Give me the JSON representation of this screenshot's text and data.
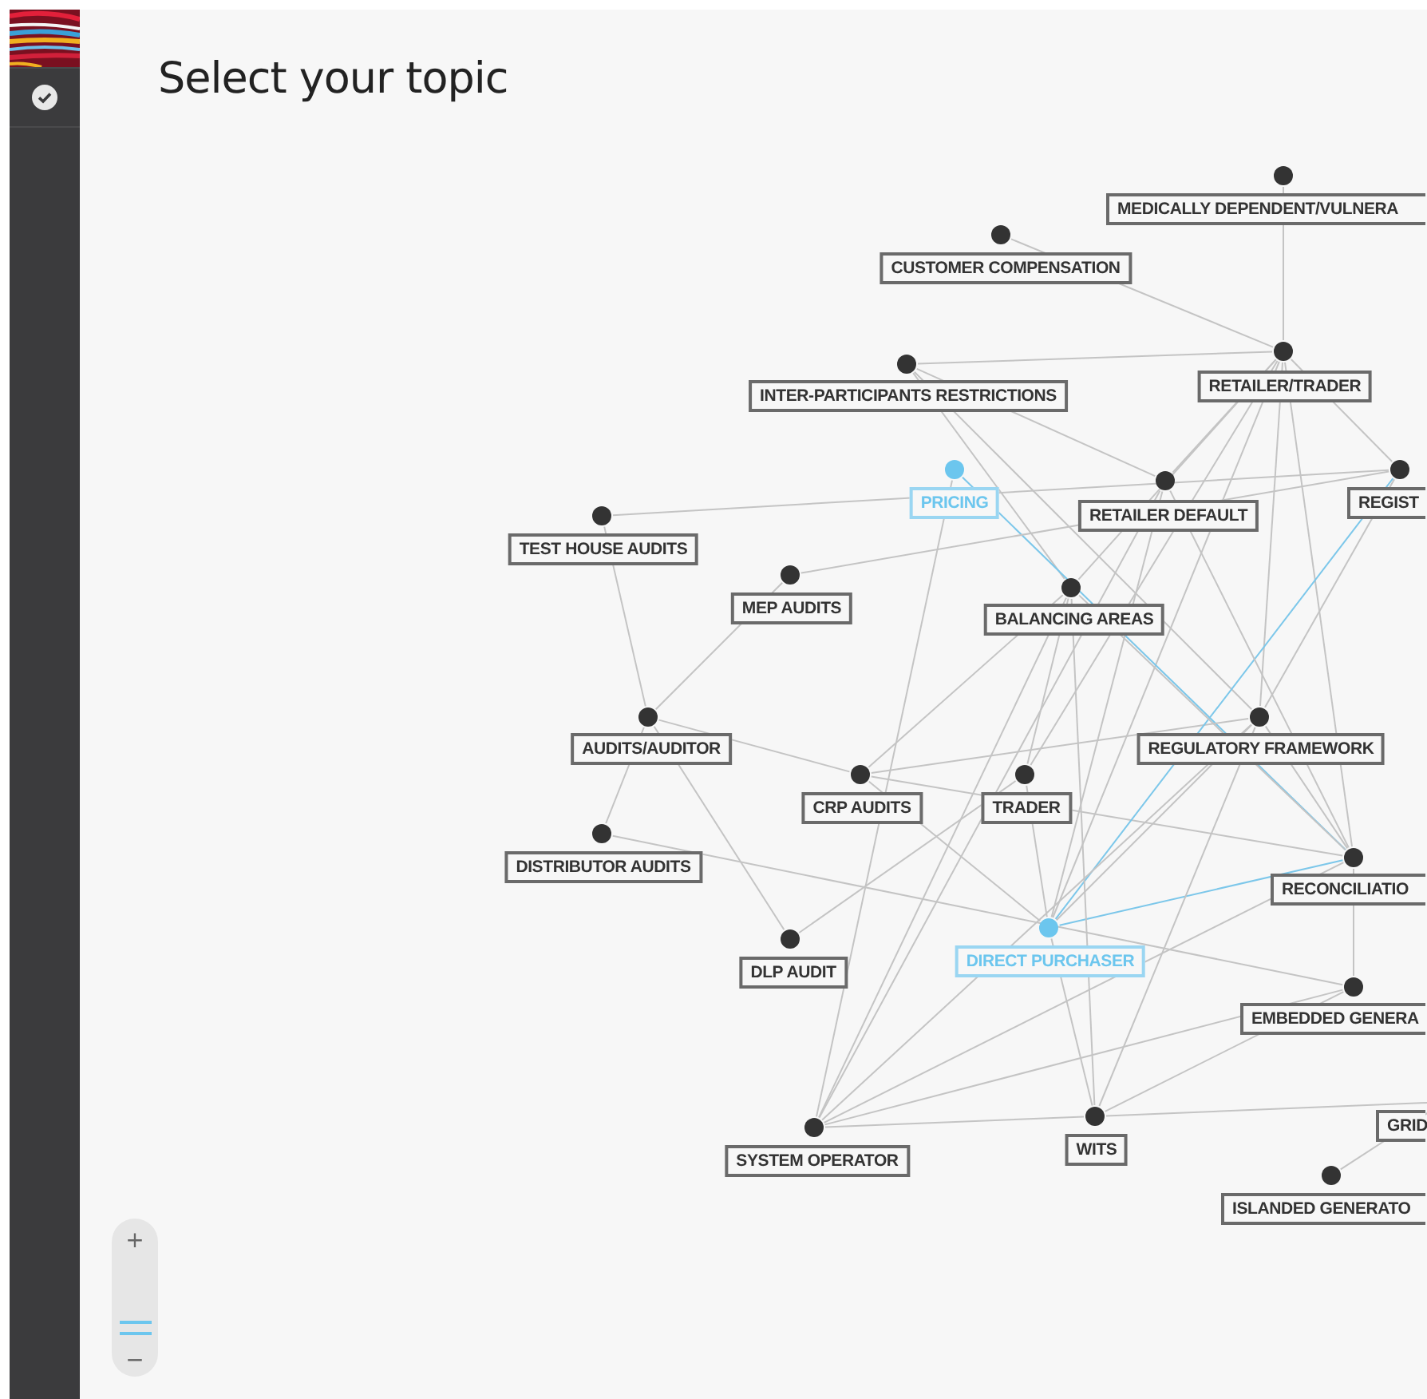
{
  "sidebar": {
    "items": [
      {
        "kind": "check",
        "selected": false
      }
    ]
  },
  "title": "Select your topic",
  "graph": {
    "nodes": [
      {
        "label": "MEDICALLY DEPENDENT/VULNERA",
        "highlighted": false
      },
      {
        "label": "CUSTOMER COMPENSATION",
        "highlighted": false
      },
      {
        "label": "INTER-PARTICIPANTS RESTRICTIONS",
        "highlighted": false
      },
      {
        "label": "RETAILER/TRADER",
        "highlighted": false
      },
      {
        "label": "PRICING",
        "highlighted": true
      },
      {
        "label": "RETAILER DEFAULT",
        "highlighted": false
      },
      {
        "label": "REGIST",
        "highlighted": false
      },
      {
        "label": "TEST HOUSE AUDITS",
        "highlighted": false
      },
      {
        "label": "MEP AUDITS",
        "highlighted": false
      },
      {
        "label": "BALANCING AREAS",
        "highlighted": false
      },
      {
        "label": "AUDITS/AUDITOR",
        "highlighted": false
      },
      {
        "label": "REGULATORY FRAMEWORK",
        "highlighted": false
      },
      {
        "label": "CRP AUDITS",
        "highlighted": false
      },
      {
        "label": "TRADER",
        "highlighted": false
      },
      {
        "label": "DISTRIBUTOR AUDITS",
        "highlighted": false
      },
      {
        "label": "RECONCILIATIO",
        "highlighted": false
      },
      {
        "label": "DLP AUDIT",
        "highlighted": false
      },
      {
        "label": "DIRECT PURCHASER",
        "highlighted": true
      },
      {
        "label": "EMBEDDED GENERA",
        "highlighted": false
      },
      {
        "label": "SYSTEM OPERATOR",
        "highlighted": false
      },
      {
        "label": "WITS",
        "highlighted": false
      },
      {
        "label": "GRID",
        "highlighted": false
      },
      {
        "label": "ISLANDED GENERATO",
        "highlighted": false
      }
    ]
  },
  "zoom": {
    "plus": "+",
    "minus": "−",
    "level": 0.25
  }
}
